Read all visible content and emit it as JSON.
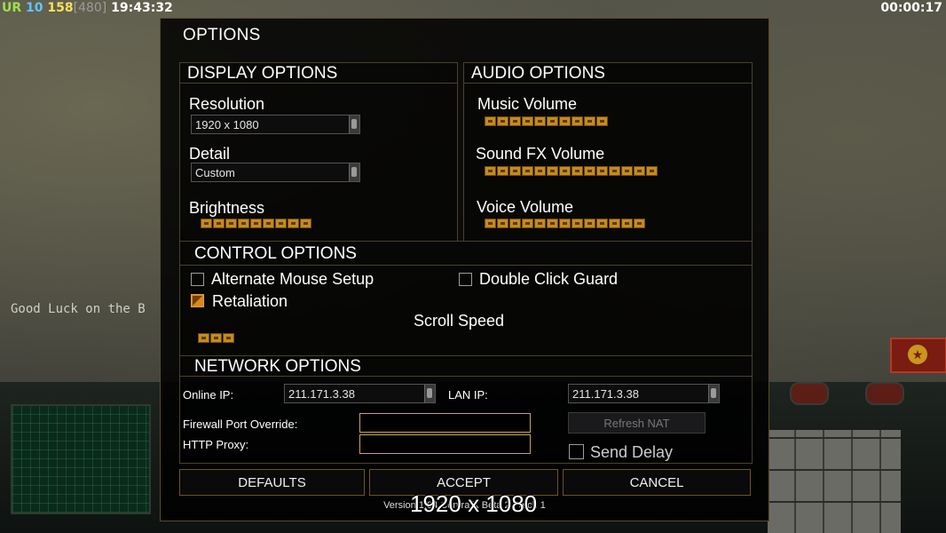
{
  "hud": {
    "faction": "UR",
    "stat_a": "10",
    "stat_b": "158",
    "stat_c": "[480]",
    "clock": "19:43:32",
    "timer": "00:00:17"
  },
  "chat_message": "Good Luck on the B",
  "dialog": {
    "title": "OPTIONS",
    "display": {
      "header": "DISPLAY OPTIONS",
      "resolution_label": "Resolution",
      "resolution_value": "1920 x 1080",
      "detail_label": "Detail",
      "detail_value": "Custom",
      "brightness_label": "Brightness",
      "brightness_level": 9
    },
    "audio": {
      "header": "AUDIO OPTIONS",
      "music_label": "Music Volume",
      "music_level": 10,
      "sfx_label": "Sound FX Volume",
      "sfx_level": 14,
      "voice_label": "Voice Volume",
      "voice_level": 13
    },
    "control": {
      "header": "CONTROL OPTIONS",
      "alt_mouse_label": "Alternate Mouse Setup",
      "alt_mouse_checked": false,
      "double_click_label": "Double Click Guard",
      "double_click_checked": false,
      "retaliation_label": "Retaliation",
      "retaliation_checked": true,
      "scroll_speed_label": "Scroll Speed",
      "scroll_speed_level": 3
    },
    "network": {
      "header": "NETWORK OPTIONS",
      "online_ip_label": "Online IP:",
      "online_ip_value": "211.171.3.38",
      "lan_ip_label": "LAN IP:",
      "lan_ip_value": "211.171.3.38",
      "firewall_label": "Firewall Port Override:",
      "firewall_value": "",
      "proxy_label": "HTTP Proxy:",
      "proxy_value": "",
      "refresh_nat_label": "Refresh NAT",
      "send_delay_label": "Send Delay",
      "send_delay_checked": false
    },
    "buttons": {
      "defaults": "DEFAULTS",
      "accept": "ACCEPT",
      "cancel": "CANCEL"
    },
    "version": "Version 1.04 Contra X Beta 2 Patch 1"
  },
  "overlay_text": "1920 x 1080",
  "colors": {
    "accent": "#c78a1c",
    "border": "#4a4230",
    "field_border": "#c8a64e"
  }
}
